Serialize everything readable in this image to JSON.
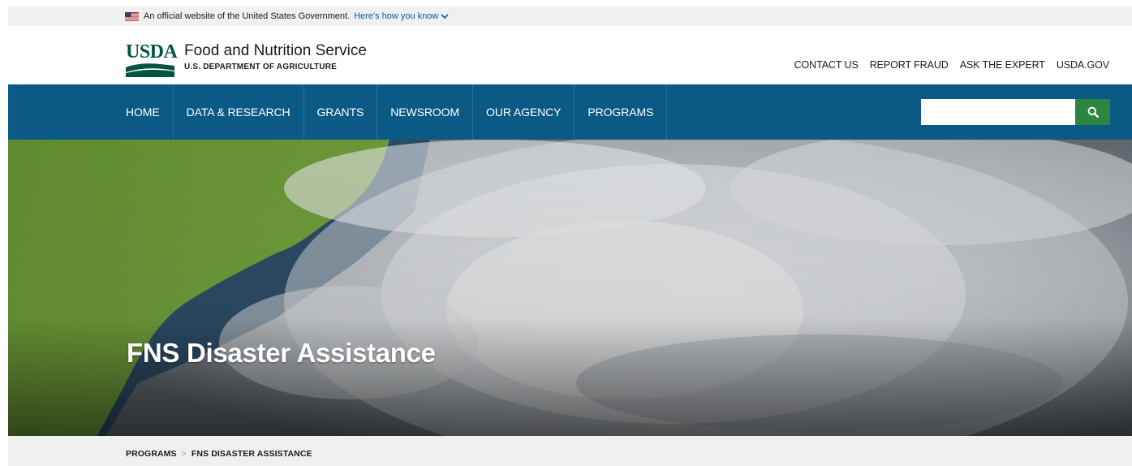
{
  "gov_banner": {
    "text": "An official website of the United States Government.",
    "link": "Here's how you know"
  },
  "header": {
    "logo_text": "USDA",
    "agency_name": "Food and Nutrition Service",
    "department": "U.S. DEPARTMENT OF AGRICULTURE",
    "utility_links": [
      "CONTACT US",
      "REPORT FRAUD",
      "ASK THE EXPERT",
      "USDA.GOV"
    ]
  },
  "main_nav": {
    "items": [
      "HOME",
      "DATA & RESEARCH",
      "GRANTS",
      "NEWSROOM",
      "OUR AGENCY",
      "PROGRAMS"
    ],
    "search": {
      "value": "",
      "placeholder": ""
    }
  },
  "hero": {
    "title": "FNS Disaster Assistance"
  },
  "breadcrumb": {
    "items": [
      "PROGRAMS",
      "FNS DISASTER ASSISTANCE"
    ],
    "separator": ">"
  },
  "colors": {
    "nav_bg": "#0b5a86",
    "search_button": "#2e8540",
    "usda_green": "#005440",
    "link_blue": "#005ea2"
  },
  "icons": {
    "flag": "us-flag-icon",
    "chevron": "chevron-down-icon",
    "search": "search-icon"
  }
}
